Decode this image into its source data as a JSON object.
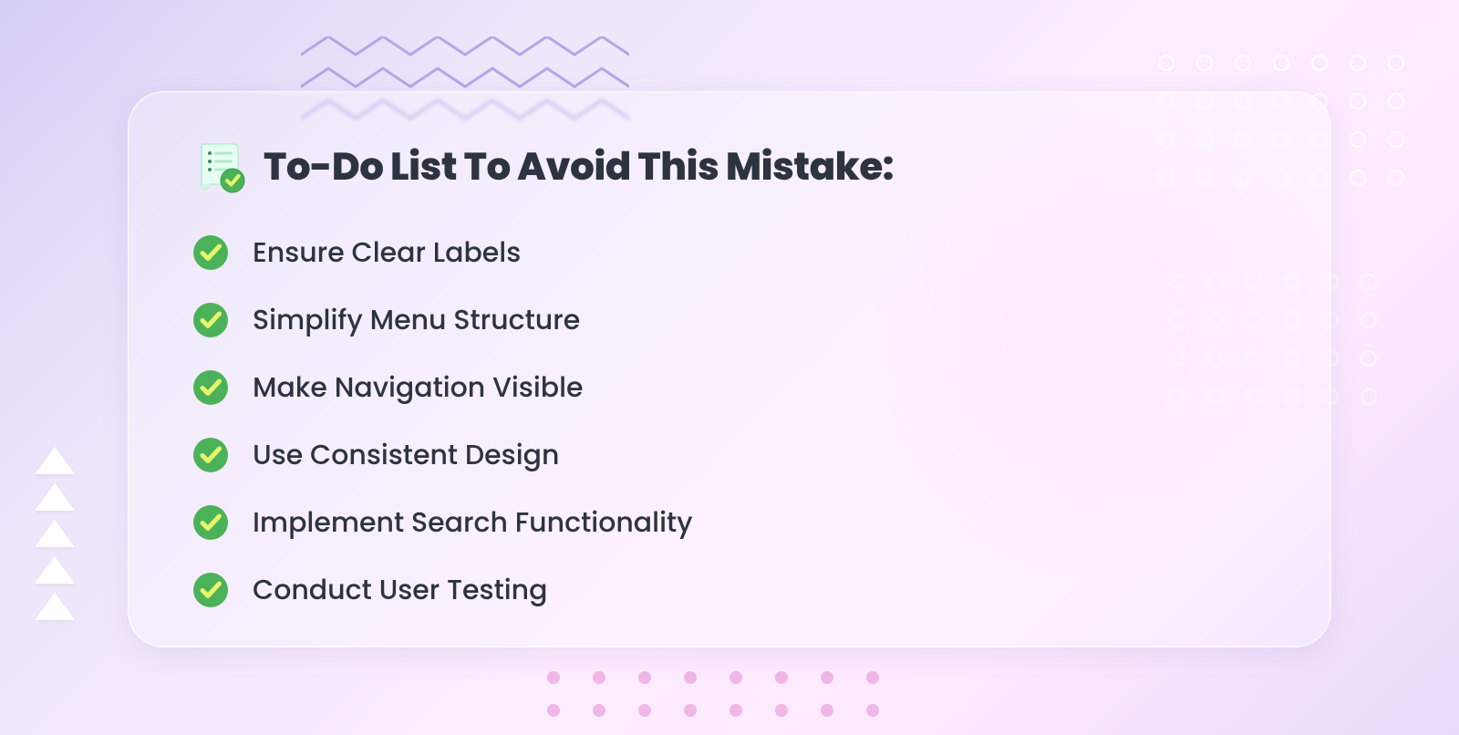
{
  "header": {
    "title": "To-Do List To Avoid This Mistake:"
  },
  "list": {
    "items": [
      {
        "label": "Ensure Clear Labels"
      },
      {
        "label": "Simplify Menu Structure"
      },
      {
        "label": "Make Navigation Visible"
      },
      {
        "label": "Use Consistent Design"
      },
      {
        "label": "Implement Search Functionality"
      },
      {
        "label": "Conduct User Testing"
      }
    ]
  }
}
